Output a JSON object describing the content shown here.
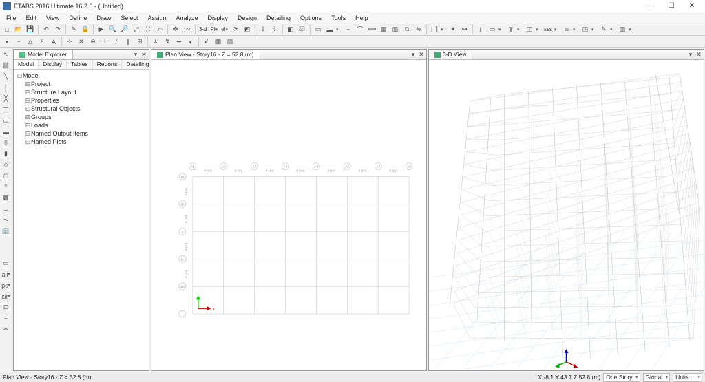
{
  "app": {
    "title": "ETABS 2016 Ultimate 16.2.0 - (Untitled)"
  },
  "menu": [
    "File",
    "Edit",
    "View",
    "Define",
    "Draw",
    "Select",
    "Assign",
    "Analyze",
    "Display",
    "Design",
    "Detailing",
    "Options",
    "Tools",
    "Help"
  ],
  "toolbar1": [
    "new",
    "open",
    "save",
    "|",
    "undo",
    "redo",
    "|",
    "lock",
    "run",
    "|",
    "arrow",
    "zoomin",
    "zoomout",
    "zoomfit",
    "zoomwin",
    "zoomprev",
    "|",
    "pan",
    "line",
    "3d",
    "|",
    "3-d",
    "Pl",
    "el",
    "rot3d",
    "persp",
    "|",
    "up",
    "down",
    "|",
    "brush"
  ],
  "toolbar1_tx": [
    "□",
    "▭",
    "▤",
    "|",
    "↶",
    "↷",
    "|",
    "✎",
    "🔒",
    "|",
    "▶",
    "🔍+",
    "🔍-",
    "⤢",
    "⛶",
    "⤺",
    "|",
    "✥",
    "〰",
    "3-d",
    "Pl⎵",
    "el⎵",
    "⟳",
    "◩",
    "|",
    "↑",
    "↓",
    "|",
    "🖌"
  ],
  "model_explorer": {
    "title": "Model Explorer",
    "tabs": [
      "Model",
      "Display",
      "Tables",
      "Reports",
      "Detailing"
    ],
    "root": "Model",
    "items": [
      "Project",
      "Structure Layout",
      "Properties",
      "Structural Objects",
      "Groups",
      "Loads",
      "Named Output Items",
      "Named Plots"
    ]
  },
  "plan_view": {
    "tab": "Plan View - Story16 - Z = 52.8 (m)"
  },
  "view3d": {
    "tab": "3-D View"
  },
  "status": {
    "left": "Plan View - Story16 - Z = 52.8 (m)",
    "coords": "X -8.1  Y 43.7  Z 52.8 (m)",
    "sel1": "One Story",
    "sel2": "Global",
    "sel3": "Units…"
  },
  "grid": {
    "cols": [
      "A1",
      "A2",
      "A3",
      "A4",
      "A5",
      "A6",
      "A7",
      "A8"
    ],
    "rows": [
      "1a",
      "1b",
      "2",
      "1c",
      "1d"
    ],
    "spacing_label": "8 (m)"
  }
}
